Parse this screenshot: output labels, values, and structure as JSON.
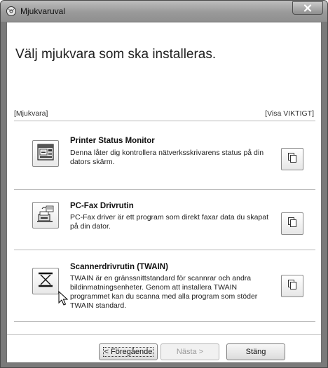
{
  "window": {
    "title": "Mjukvaruval"
  },
  "main": {
    "heading": "Välj mjukvara som ska installeras.",
    "left_tag": "[Mjukvara]",
    "right_tag": "[Visa VIKTIGT]"
  },
  "items": [
    {
      "title": "Printer Status Monitor",
      "description": "Denna låter dig kontrollera nätverksskrivarens status på din dators skärm.",
      "icon": "printer-status-monitor-icon"
    },
    {
      "title": "PC-Fax Drivrutin",
      "description": "PC-Fax driver är ett program som direkt faxar data du skapat på din dator.",
      "icon": "pc-fax-icon"
    },
    {
      "title": "Scannerdrivrutin (TWAIN)",
      "description": "TWAIN är en gränssnittstandard för scannrar och andra bildinmatningsenheter. Genom att installera TWAIN programmet kan du scanna med alla program som stöder TWAIN standard.",
      "icon": "scanner-icon"
    }
  ],
  "footer": {
    "back_label": "< Föregående",
    "next_label": "Nästa >",
    "close_label": "Stäng"
  },
  "colors": {
    "titlebar": "#9a9a9a",
    "window_frame": "#7a7a7a",
    "client_bg": "#ffffff"
  }
}
